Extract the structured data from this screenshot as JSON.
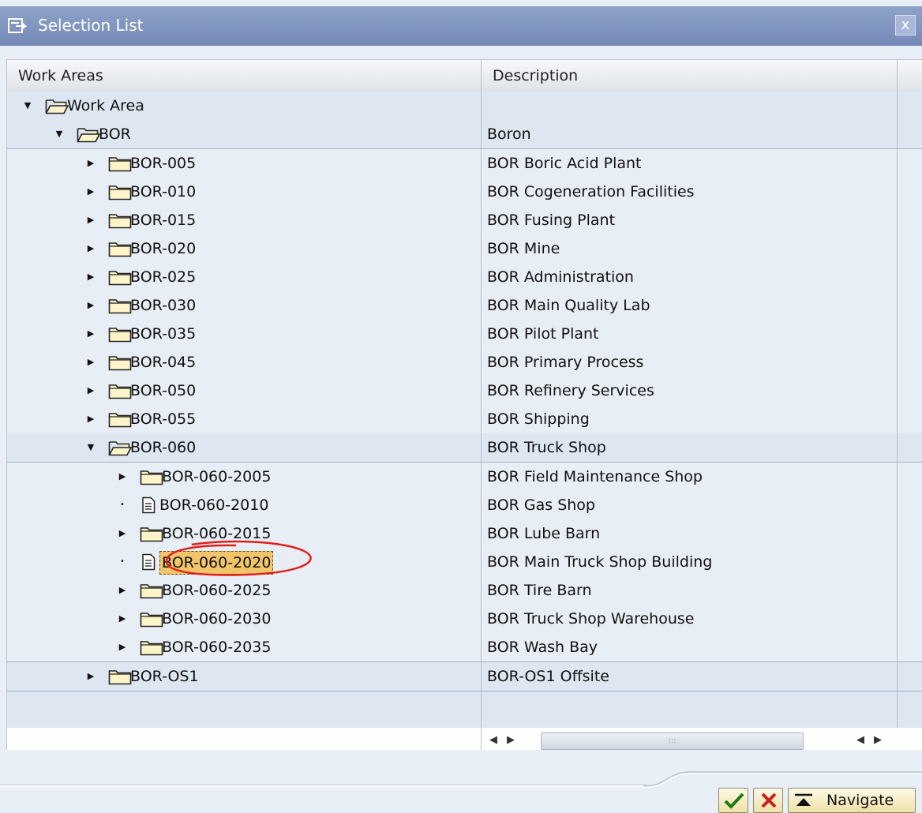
{
  "window": {
    "title": "Selection List",
    "close_label": "x"
  },
  "table": {
    "columns": [
      "Work Areas",
      "Description"
    ],
    "rows": [
      {
        "level": 0,
        "expander": "expanded",
        "icon": "folder-open-icon",
        "label": "Work Area",
        "description": "",
        "selected": false
      },
      {
        "level": 1,
        "expander": "expanded",
        "icon": "folder-open-icon",
        "label": "BOR",
        "description": "Boron",
        "selected": false
      },
      {
        "level": 2,
        "expander": "collapsed",
        "icon": "folder-icon",
        "label": "BOR-005",
        "description": "BOR Boric Acid Plant",
        "selected": false
      },
      {
        "level": 2,
        "expander": "collapsed",
        "icon": "folder-icon",
        "label": "BOR-010",
        "description": "BOR Cogeneration Facilities",
        "selected": false
      },
      {
        "level": 2,
        "expander": "collapsed",
        "icon": "folder-icon",
        "label": "BOR-015",
        "description": "BOR Fusing Plant",
        "selected": false
      },
      {
        "level": 2,
        "expander": "collapsed",
        "icon": "folder-icon",
        "label": "BOR-020",
        "description": "BOR Mine",
        "selected": false
      },
      {
        "level": 2,
        "expander": "collapsed",
        "icon": "folder-icon",
        "label": "BOR-025",
        "description": "BOR Administration",
        "selected": false
      },
      {
        "level": 2,
        "expander": "collapsed",
        "icon": "folder-icon",
        "label": "BOR-030",
        "description": "BOR Main Quality Lab",
        "selected": false
      },
      {
        "level": 2,
        "expander": "collapsed",
        "icon": "folder-icon",
        "label": "BOR-035",
        "description": "BOR Pilot Plant",
        "selected": false
      },
      {
        "level": 2,
        "expander": "collapsed",
        "icon": "folder-icon",
        "label": "BOR-045",
        "description": "BOR Primary Process",
        "selected": false
      },
      {
        "level": 2,
        "expander": "collapsed",
        "icon": "folder-icon",
        "label": "BOR-050",
        "description": "BOR Refinery Services",
        "selected": false
      },
      {
        "level": 2,
        "expander": "collapsed",
        "icon": "folder-icon",
        "label": "BOR-055",
        "description": "BOR Shipping",
        "selected": false
      },
      {
        "level": 2,
        "expander": "expanded",
        "icon": "folder-open-icon",
        "label": "BOR-060",
        "description": "BOR Truck Shop",
        "selected": false
      },
      {
        "level": 3,
        "expander": "collapsed",
        "icon": "folder-icon",
        "label": "BOR-060-2005",
        "description": "BOR Field Maintenance Shop",
        "selected": false
      },
      {
        "level": 3,
        "expander": "leaf",
        "icon": "document-icon",
        "label": "BOR-060-2010",
        "description": "BOR Gas Shop",
        "selected": false
      },
      {
        "level": 3,
        "expander": "collapsed",
        "icon": "folder-icon",
        "label": "BOR-060-2015",
        "description": "BOR Lube Barn",
        "selected": false
      },
      {
        "level": 3,
        "expander": "leaf",
        "icon": "document-icon",
        "label": "BOR-060-2020",
        "description": "BOR Main Truck Shop Building",
        "selected": true
      },
      {
        "level": 3,
        "expander": "collapsed",
        "icon": "folder-icon",
        "label": "BOR-060-2025",
        "description": "BOR Tire Barn",
        "selected": false
      },
      {
        "level": 3,
        "expander": "collapsed",
        "icon": "folder-icon",
        "label": "BOR-060-2030",
        "description": "BOR Truck Shop Warehouse",
        "selected": false
      },
      {
        "level": 3,
        "expander": "collapsed",
        "icon": "folder-icon",
        "label": "BOR-060-2035",
        "description": "BOR Wash Bay",
        "selected": false
      },
      {
        "level": 2,
        "expander": "collapsed",
        "icon": "folder-icon",
        "label": "BOR-OS1",
        "description": "BOR-OS1 Offsite",
        "selected": false
      }
    ]
  },
  "scrollbar": {
    "left_arrow": "◀",
    "right_arrow": "▶",
    "grip": ":::"
  },
  "buttons": {
    "ok_icon": "checkmark-icon",
    "cancel_icon": "cancel-x-icon",
    "navigate_icon": "navigate-top-icon",
    "navigate_label": "Navigate"
  },
  "colors": {
    "titlebar": "#7f94c0",
    "row_band": "#dde6f1",
    "selection": "#f3c56a",
    "annotation_circle": "#e0201a",
    "button_face": "#f4ecc5"
  }
}
